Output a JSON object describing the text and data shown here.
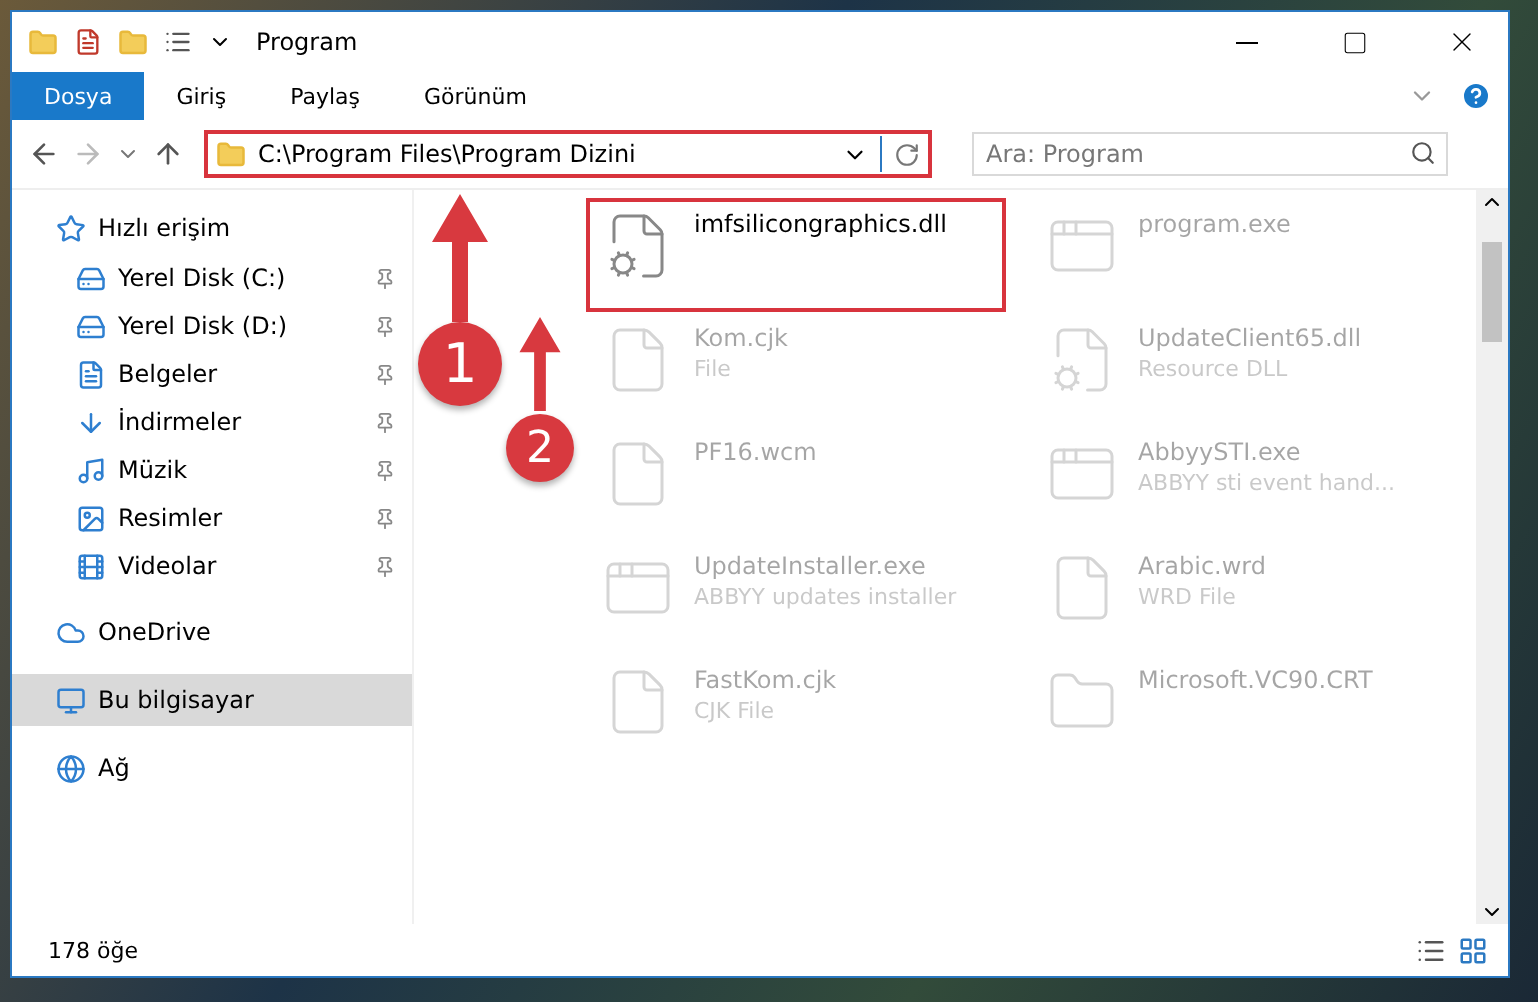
{
  "window": {
    "title": "Program"
  },
  "ribbon_tabs": [
    {
      "label": "Dosya",
      "selected": true
    },
    {
      "label": "Giriş",
      "selected": false
    },
    {
      "label": "Paylaş",
      "selected": false
    },
    {
      "label": "Görünüm",
      "selected": false
    }
  ],
  "address": {
    "path": "C:\\Program Files\\Program Dizini",
    "highlighted": true
  },
  "search": {
    "placeholder": "Ara: Program"
  },
  "sidebar": {
    "items": [
      {
        "label": "Hızlı erişim",
        "kind": "star",
        "pinned": false,
        "selected": false,
        "section": true
      },
      {
        "label": "Yerel Disk (C:)",
        "kind": "drive-c",
        "pinned": true,
        "selected": false,
        "section": false
      },
      {
        "label": "Yerel Disk (D:)",
        "kind": "drive",
        "pinned": true,
        "selected": false,
        "section": false
      },
      {
        "label": "Belgeler",
        "kind": "document",
        "pinned": true,
        "selected": false,
        "section": false
      },
      {
        "label": "İndirmeler",
        "kind": "download",
        "pinned": true,
        "selected": false,
        "section": false
      },
      {
        "label": "Müzik",
        "kind": "music",
        "pinned": true,
        "selected": false,
        "section": false
      },
      {
        "label": "Resimler",
        "kind": "picture",
        "pinned": true,
        "selected": false,
        "section": false
      },
      {
        "label": "Videolar",
        "kind": "video",
        "pinned": true,
        "selected": false,
        "section": false
      },
      {
        "label": "OneDrive",
        "kind": "cloud",
        "pinned": false,
        "selected": false,
        "section": true
      },
      {
        "label": "Bu bilgisayar",
        "kind": "computer",
        "pinned": false,
        "selected": true,
        "section": true
      },
      {
        "label": "Ağ",
        "kind": "network",
        "pinned": false,
        "selected": false,
        "section": true
      }
    ]
  },
  "files": [
    {
      "name": "imfsilicongraphics.dll",
      "kind": "dll",
      "highlighted": true,
      "faded": false
    },
    {
      "name": "program.exe",
      "kind": "app",
      "highlighted": false,
      "faded": true
    },
    {
      "name": "Kom.cjk",
      "type": "File",
      "kind": "blank",
      "highlighted": false,
      "faded": true
    },
    {
      "name": "UpdateClient65.dll",
      "type": "Resource DLL",
      "kind": "dll",
      "highlighted": false,
      "faded": true
    },
    {
      "name": "PF16.wcm",
      "kind": "blank",
      "highlighted": false,
      "faded": true
    },
    {
      "name": "AbbyySTI.exe",
      "type": "ABBYY sti event hand...",
      "kind": "window",
      "highlighted": false,
      "faded": true
    },
    {
      "name": "UpdateInstaller.exe",
      "type": "ABBYY updates installer",
      "kind": "window",
      "highlighted": false,
      "faded": true
    },
    {
      "name": "Arabic.wrd",
      "type": "WRD File",
      "kind": "blank",
      "highlighted": false,
      "faded": true
    },
    {
      "name": "FastKom.cjk",
      "type": "CJK File",
      "kind": "blank",
      "highlighted": false,
      "faded": true
    },
    {
      "name": "Microsoft.VC90.CRT",
      "kind": "folder",
      "highlighted": false,
      "faded": true
    }
  ],
  "annotations": [
    "1",
    "2"
  ],
  "status_bar": {
    "count": "178 öğe"
  }
}
